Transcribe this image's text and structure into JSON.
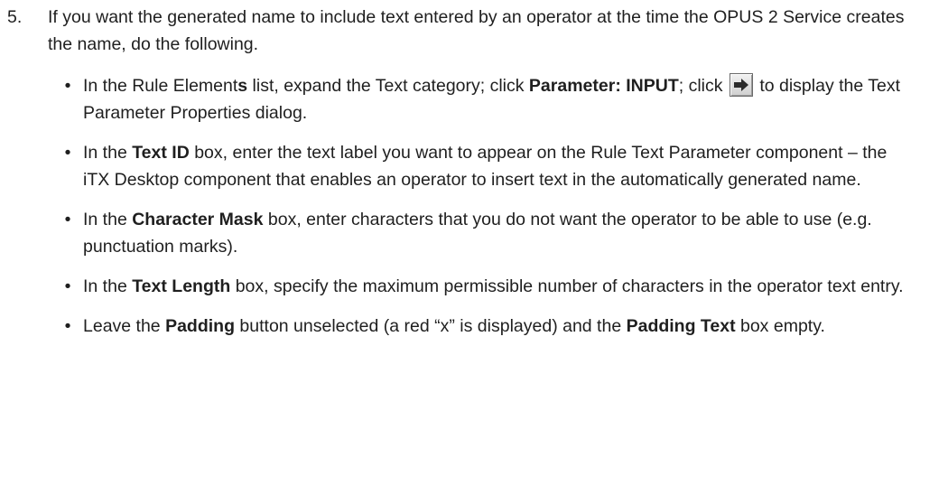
{
  "step": {
    "number": "5.",
    "intro": "If you want the generated name to include text entered by an operator at the time the OPUS 2 Service creates the name, do the following."
  },
  "bullets": [
    {
      "p1": "In the Rule Element",
      "b1": "s",
      "p2": " list, expand the Text category; click ",
      "b2": "Parameter: INPUT",
      "p3": "; click ",
      "icon": "right-arrow-icon",
      "p4": " to display the Text Parameter Properties dialog."
    },
    {
      "p1": "In the ",
      "b1": "Text ID",
      "p2": " box, enter the text label you want to appear on the Rule Text Parameter component – the iTX Desktop component that enables an operator to insert text in the automatically generated name."
    },
    {
      "p1": "In the ",
      "b1": "Character Mask",
      "p2": " box, enter characters that you do not want the operator to be able to use (e.g. punctuation marks)."
    },
    {
      "p1": "In the ",
      "b1": "Text Length",
      "p2": " box, specify the maximum permissible number of characters in the operator text entry."
    },
    {
      "p1": "Leave the ",
      "b1": "Padding",
      "p2": " button unselected (a red “x” is displayed) and the ",
      "b2": "Padding Text",
      "p3": " box empty."
    }
  ],
  "bullet_symbol": "•",
  "colors": {
    "text": "#1f1f1f",
    "icon_arrow": "#2b2b2b"
  }
}
